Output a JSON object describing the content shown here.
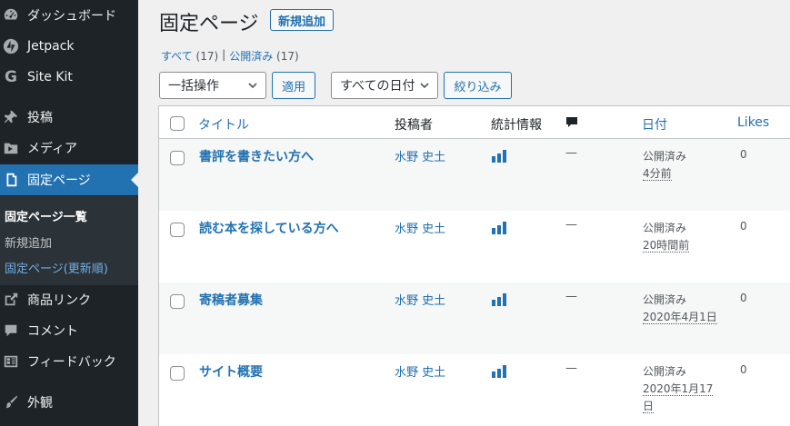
{
  "sidebar": {
    "items": [
      {
        "label": "ダッシュボード",
        "icon": "dashboard-icon"
      },
      {
        "label": "Jetpack",
        "icon": "jetpack-icon"
      },
      {
        "label": "Site Kit",
        "icon": "google-g-icon"
      },
      {
        "label": "投稿",
        "icon": "pushpin-icon"
      },
      {
        "label": "メディア",
        "icon": "media-icon"
      },
      {
        "label": "固定ページ",
        "icon": "page-icon",
        "active": true
      },
      {
        "label": "商品リンク",
        "icon": "external-link-icon"
      },
      {
        "label": "コメント",
        "icon": "comment-icon"
      },
      {
        "label": "フィードバック",
        "icon": "feedback-icon"
      },
      {
        "label": "外観",
        "icon": "paintbrush-icon"
      }
    ],
    "submenu": [
      {
        "label": "固定ページ一覧",
        "state": "current"
      },
      {
        "label": "新規追加",
        "state": "normal"
      },
      {
        "label": "固定ページ(更新順)",
        "state": "link"
      }
    ]
  },
  "header": {
    "title": "固定ページ",
    "add_new": "新規追加"
  },
  "filters": {
    "all_label": "すべて",
    "all_count": "(17)",
    "separator": "|",
    "published_label": "公開済み",
    "published_count": "(17)"
  },
  "toolbar": {
    "bulk_action": "一括操作",
    "apply": "適用",
    "date_filter": "すべての日付",
    "filter": "絞り込み"
  },
  "table": {
    "columns": {
      "title": "タイトル",
      "author": "投稿者",
      "stats": "統計情報",
      "date": "日付",
      "likes": "Likes"
    },
    "rows": [
      {
        "title": "書評を書きたい方へ",
        "author": "水野 史土",
        "comments": "—",
        "status": "公開済み",
        "date": "4分前",
        "likes": "0"
      },
      {
        "title": "読む本を探している方へ",
        "author": "水野 史土",
        "comments": "—",
        "status": "公開済み",
        "date": "20時間前",
        "likes": "0"
      },
      {
        "title": "寄稿者募集",
        "author": "水野 史土",
        "comments": "—",
        "status": "公開済み",
        "date": "2020年4月1日",
        "likes": "0"
      },
      {
        "title": "サイト概要",
        "author": "水野 史土",
        "comments": "—",
        "status": "公開済み",
        "date": "2020年1月17日",
        "likes": "0"
      }
    ]
  },
  "colors": {
    "sidebar_bg": "#1d2327",
    "active_bg": "#2271b1",
    "link": "#2271b1"
  }
}
